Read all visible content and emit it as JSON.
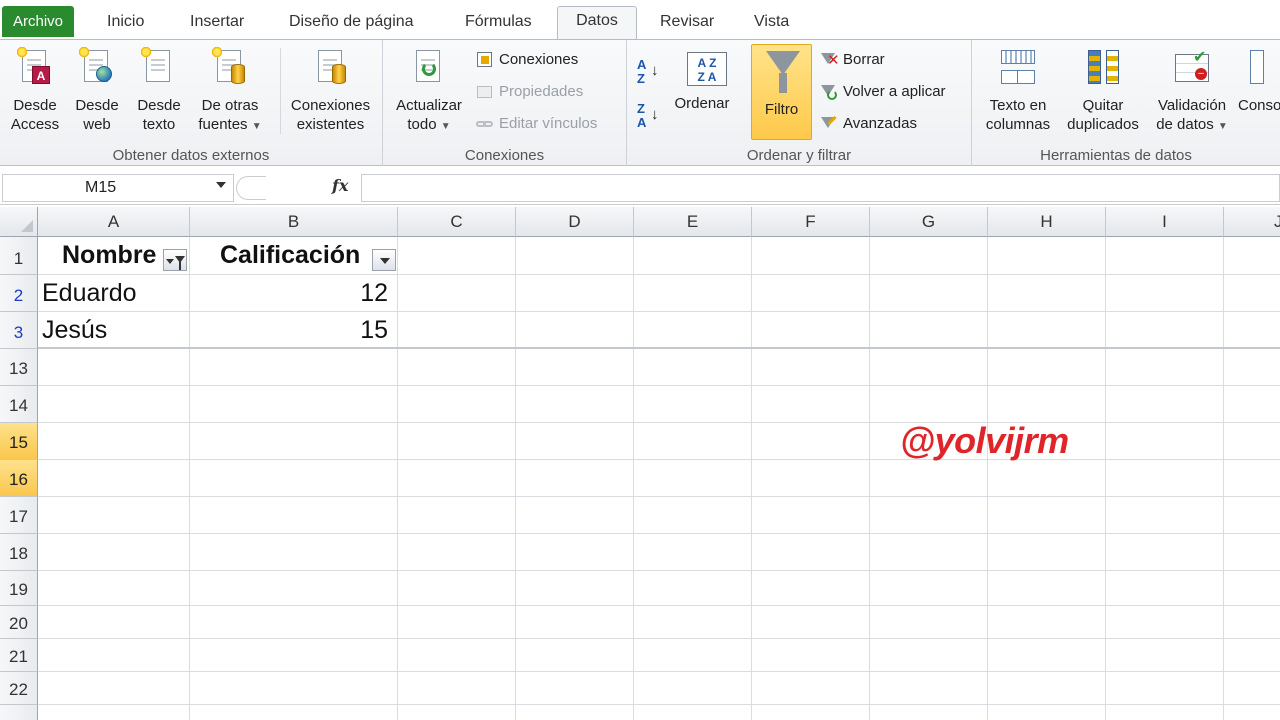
{
  "tabs": [
    "Archivo",
    "Inicio",
    "Insertar",
    "Diseño de página",
    "Fórmulas",
    "Datos",
    "Revisar",
    "Vista"
  ],
  "active_tab": "Datos",
  "ribbon": {
    "get_external": {
      "label": "Obtener datos externos",
      "buttons": [
        {
          "l1": "Desde",
          "l2": "Access"
        },
        {
          "l1": "Desde",
          "l2": "web"
        },
        {
          "l1": "Desde",
          "l2": "texto"
        },
        {
          "l1": "De otras",
          "l2": "fuentes"
        },
        {
          "l1": "Conexiones",
          "l2": "existentes"
        }
      ]
    },
    "connections": {
      "label": "Conexiones",
      "refresh_l1": "Actualizar",
      "refresh_l2": "todo",
      "conexiones": "Conexiones",
      "propiedades": "Propiedades",
      "editar": "Editar vínculos"
    },
    "sort_filter": {
      "label": "Ordenar y filtrar",
      "ordenar": "Ordenar",
      "filtro": "Filtro",
      "borrar": "Borrar",
      "volver": "Volver a aplicar",
      "avanzadas": "Avanzadas"
    },
    "tools": {
      "label": "Herramientas de datos",
      "buttons": [
        {
          "l1": "Texto en",
          "l2": "columnas"
        },
        {
          "l1": "Quitar",
          "l2": "duplicados"
        },
        {
          "l1": "Validación",
          "l2": "de datos"
        },
        {
          "l1": "Conso",
          "l2": ""
        }
      ]
    }
  },
  "formula_bar": {
    "name_box": "M15",
    "fx": "fx",
    "value": ""
  },
  "columns": [
    "A",
    "B",
    "C",
    "D",
    "E",
    "F",
    "G",
    "H",
    "I",
    "J"
  ],
  "rows": [
    "1",
    "2",
    "3",
    "13",
    "14",
    "15",
    "16",
    "17",
    "18",
    "19",
    "20",
    "21",
    "22"
  ],
  "table": {
    "headers": [
      "Nombre",
      "Calificación"
    ],
    "data": [
      {
        "nombre": "Eduardo",
        "calificacion": "12"
      },
      {
        "nombre": "Jesús",
        "calificacion": "15"
      }
    ]
  },
  "watermark": "@yolvijrm",
  "colors": {
    "file_tab": "#2a8a2e",
    "filter_active": "#ffc94a",
    "accent": "#d10a0a",
    "filtered_rows": "#1a3cc7",
    "watermark": "#e0252a"
  }
}
